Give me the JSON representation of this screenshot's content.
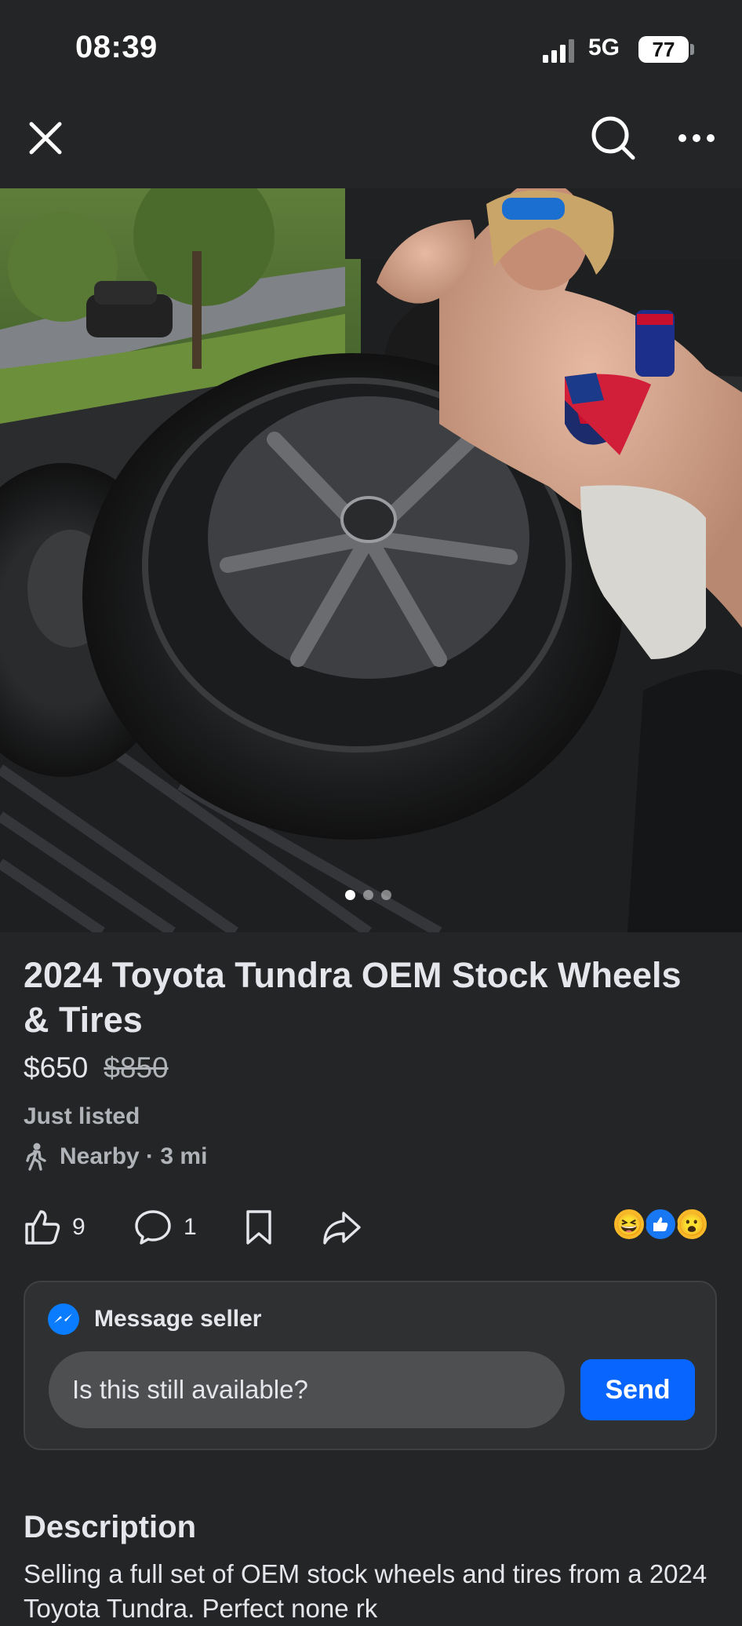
{
  "status": {
    "time": "08:39",
    "network": "5G",
    "battery": "77"
  },
  "nav": {
    "close_icon": "close-icon",
    "search_icon": "search-icon",
    "more_icon": "more-icon"
  },
  "photo": {
    "count": 3,
    "active_index": 0
  },
  "listing": {
    "title": "2024 Toyota Tundra OEM Stock Wheels & Tires",
    "price": "$650",
    "original_price": "$850",
    "listed": "Just listed",
    "location": "Nearby · 3 mi"
  },
  "actions": {
    "likes": "9",
    "comments": "1"
  },
  "message": {
    "header": "Message seller",
    "input_value": "Is this still available?",
    "send_label": "Send"
  },
  "description": {
    "heading": "Description",
    "text": "Selling a full set of OEM stock wheels and tires from a 2024 Toyota Tundra. Perfect none rk"
  },
  "colors": {
    "accent": "#0866ff",
    "background": "#242526",
    "card": "#2f3031"
  }
}
